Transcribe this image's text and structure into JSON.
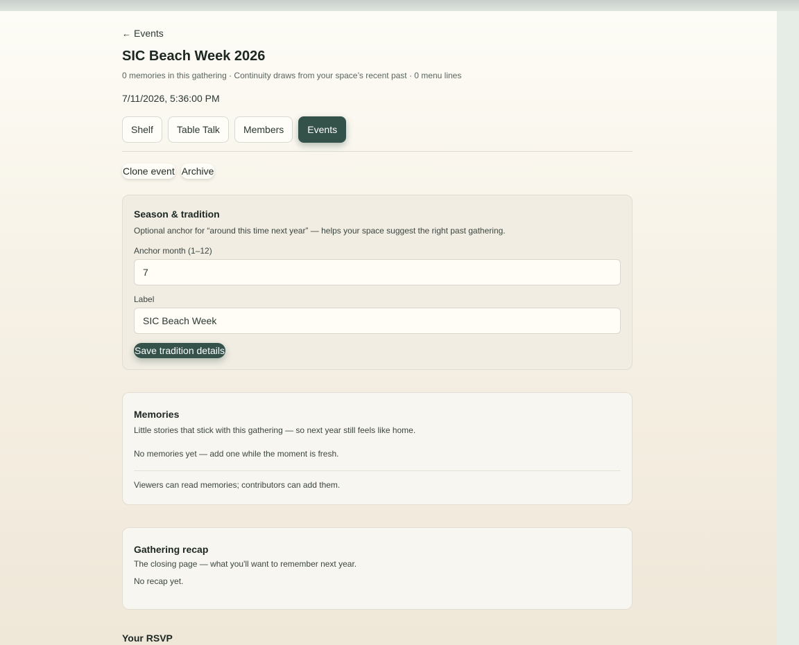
{
  "nav": {
    "back_arrow": "←",
    "back_label": "Events"
  },
  "event": {
    "title": "SIC Beach Week 2026",
    "subtitle": "0 memories in this gathering · Continuity draws from your space’s recent past · 0 menu lines",
    "datetime": "7/11/2026, 5:36:00 PM"
  },
  "tabs": [
    {
      "label": "Shelf",
      "active": false
    },
    {
      "label": "Table Talk",
      "active": false
    },
    {
      "label": "Members",
      "active": false
    },
    {
      "label": "Events",
      "active": true
    }
  ],
  "actions": {
    "clone_label": "Clone event",
    "archive_label": "Archive"
  },
  "tradition": {
    "heading": "Season & tradition",
    "description": "Optional anchor for “around this time next year” — helps your space suggest the right past gathering.",
    "month_label": "Anchor month (1–12)",
    "month_value": "7",
    "label_label": "Label",
    "label_value": "SIC Beach Week",
    "save_label": "Save tradition details"
  },
  "memories": {
    "heading": "Memories",
    "description": "Little stories that stick with this gathering — so next year still feels like home.",
    "empty": "No memories yet — add one while the moment is fresh.",
    "note": "Viewers can read memories; contributors can add them."
  },
  "recap": {
    "heading": "Gathering recap",
    "description": "The closing page — what you'll want to remember next year.",
    "empty": "No recap yet."
  },
  "rsvp": {
    "heading": "Your RSVP"
  },
  "colors": {
    "accent": "#34524a",
    "page_bg": "#f7f2e7"
  }
}
